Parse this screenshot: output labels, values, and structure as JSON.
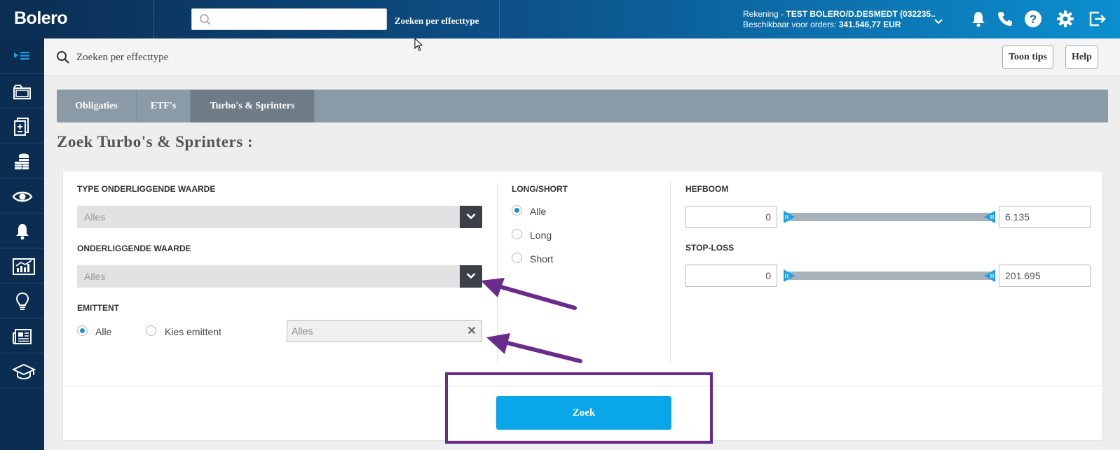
{
  "app": {
    "logo": "Bolero"
  },
  "topbar": {
    "search_placeholder": "",
    "search_link": "Zoeken per effecttype",
    "account_prefix": "Rekening - ",
    "account_name": "TEST BOLERO/D.DESMEDT (032235..",
    "available_prefix": "Beschikbaar voor orders: ",
    "available_value": "341.546,77 EUR",
    "icons": [
      "bell-icon",
      "phone-icon",
      "help-icon",
      "gear-icon",
      "logout-icon"
    ]
  },
  "sidebar": {
    "items": [
      "menu-toggle-icon",
      "portfolio-icon",
      "orders-icon",
      "coins-icon",
      "watchlist-icon",
      "alerts-icon",
      "charts-icon",
      "ideas-icon",
      "news-icon",
      "academy-icon"
    ]
  },
  "breadcrumb": {
    "title": "Zoeken per effecttype",
    "tips_label": "Toon tips",
    "help_label": "Help"
  },
  "tabs": [
    {
      "label": "Obligaties",
      "active": false
    },
    {
      "label": "ETF's",
      "active": false
    },
    {
      "label": "Turbo's & Sprinters",
      "active": true
    }
  ],
  "page_title": "Zoek Turbo's & Sprinters :",
  "form": {
    "type_underlying": {
      "label": "TYPE ONDERLIGGENDE WAARDE",
      "value": "Alles"
    },
    "underlying": {
      "label": "ONDERLIGGENDE WAARDE",
      "value": "Alles"
    },
    "issuer": {
      "label": "EMITTENT",
      "options": [
        "Alle",
        "Kies emittent"
      ],
      "selected": "Alle",
      "input_value": "Alles"
    },
    "long_short": {
      "label": "LONG/SHORT",
      "options": [
        "Alle",
        "Long",
        "Short"
      ],
      "selected": "Alle"
    },
    "leverage": {
      "label": "HEFBOOM",
      "min": "0",
      "max": "6.135"
    },
    "stop_loss": {
      "label": "STOP-LOSS",
      "min": "0",
      "max": "201.695"
    },
    "submit_label": "Zoek"
  },
  "colors": {
    "accent": "#0aa6ea",
    "annotation": "#6a2b8c",
    "sidebar": "#0b2d52"
  }
}
